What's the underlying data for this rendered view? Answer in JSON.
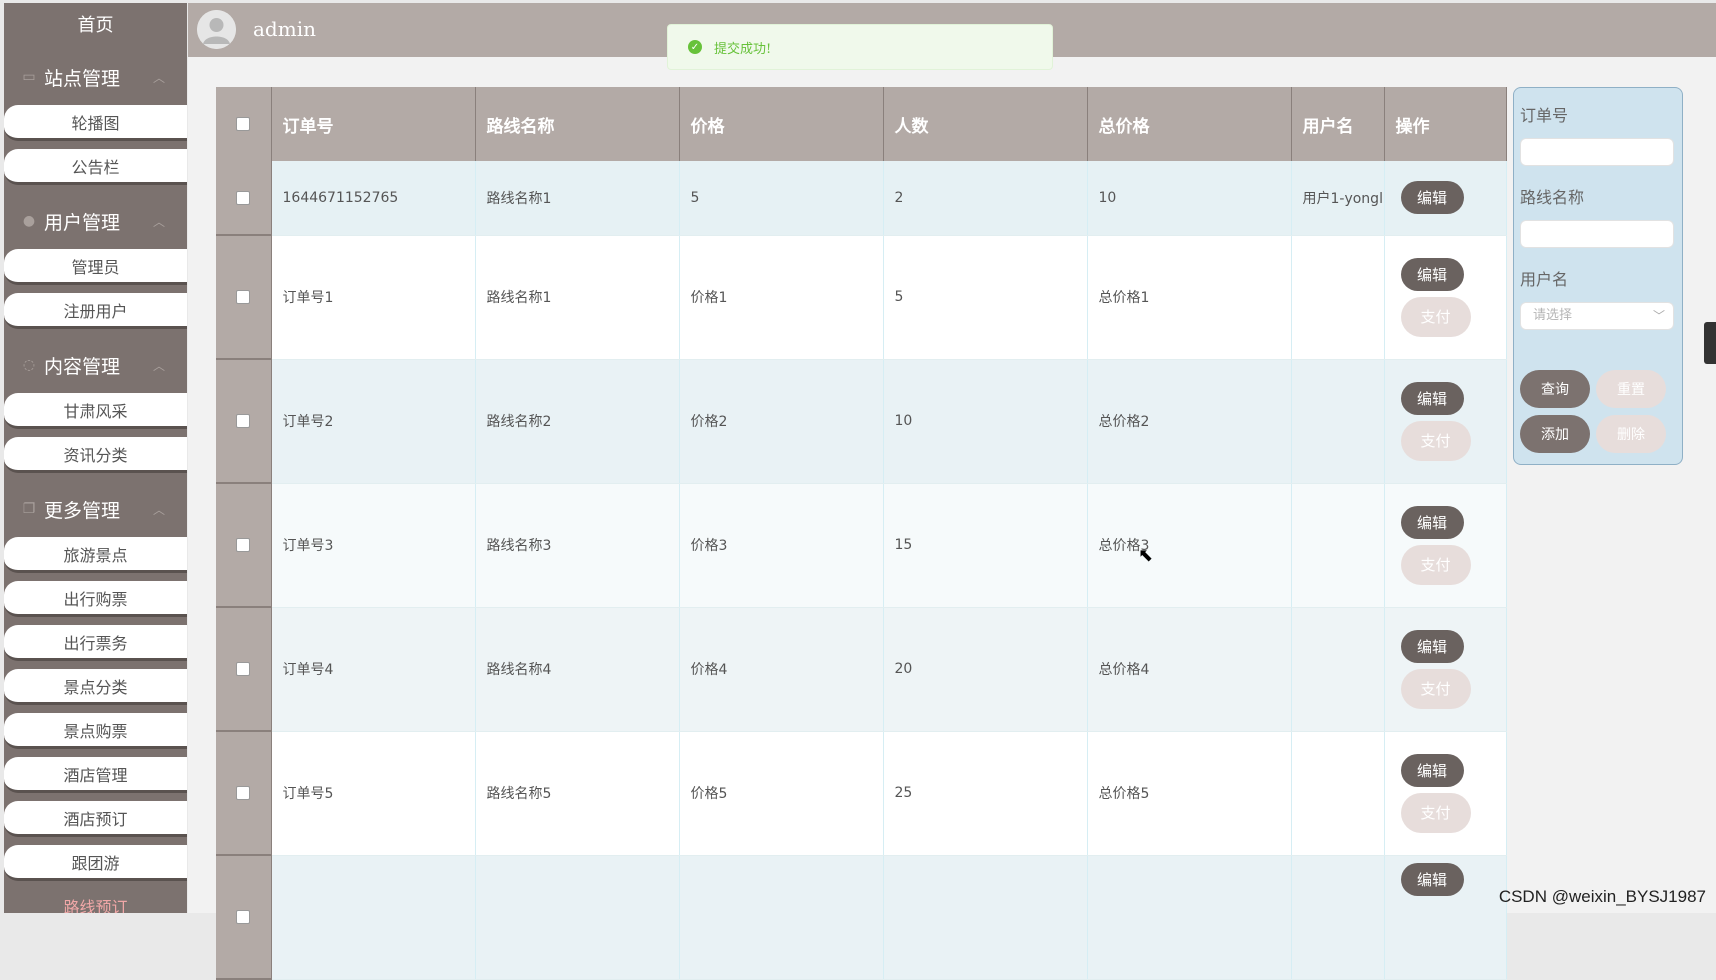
{
  "sidebar": {
    "home": "首页",
    "groups": [
      {
        "title": "站点管理",
        "items": [
          "轮播图",
          "公告栏"
        ]
      },
      {
        "title": "用户管理",
        "items": [
          "管理员",
          "注册用户"
        ]
      },
      {
        "title": "内容管理",
        "items": [
          "甘肃风采",
          "资讯分类"
        ]
      },
      {
        "title": "更多管理",
        "items": [
          "旅游景点",
          "出行购票",
          "出行票务",
          "景点分类",
          "景点购票",
          "酒店管理",
          "酒店预订",
          "跟团游",
          "路线预订"
        ]
      }
    ],
    "active_item": "路线预订"
  },
  "header": {
    "username": "admin"
  },
  "toast": {
    "message": "提交成功!",
    "type": "success"
  },
  "table": {
    "columns": [
      "订单号",
      "路线名称",
      "价格",
      "人数",
      "总价格",
      "用户名",
      "操作"
    ],
    "rows": [
      {
        "order_no": "1644671152765",
        "route": "路线名称1",
        "price": "5",
        "people": "2",
        "total": "10",
        "user": "用户1-yongl",
        "actions": [
          "编辑"
        ]
      },
      {
        "order_no": "订单号1",
        "route": "路线名称1",
        "price": "价格1",
        "people": "5",
        "total": "总价格1",
        "user": "",
        "actions": [
          "编辑",
          "支付"
        ]
      },
      {
        "order_no": "订单号2",
        "route": "路线名称2",
        "price": "价格2",
        "people": "10",
        "total": "总价格2",
        "user": "",
        "actions": [
          "编辑",
          "支付"
        ]
      },
      {
        "order_no": "订单号3",
        "route": "路线名称3",
        "price": "价格3",
        "people": "15",
        "total": "总价格3",
        "user": "",
        "actions": [
          "编辑",
          "支付"
        ]
      },
      {
        "order_no": "订单号4",
        "route": "路线名称4",
        "price": "价格4",
        "people": "20",
        "total": "总价格4",
        "user": "",
        "actions": [
          "编辑",
          "支付"
        ]
      },
      {
        "order_no": "订单号5",
        "route": "路线名称5",
        "price": "价格5",
        "people": "25",
        "total": "总价格5",
        "user": "",
        "actions": [
          "编辑",
          "支付"
        ]
      },
      {
        "order_no": "",
        "route": "",
        "price": "",
        "people": "",
        "total": "",
        "user": "",
        "actions": [
          "编辑"
        ]
      }
    ]
  },
  "search": {
    "order_label": "订单号",
    "route_label": "路线名称",
    "user_label": "用户名",
    "user_placeholder": "请选择",
    "query": "查询",
    "reset": "重置",
    "add": "添加",
    "delete": "删除"
  },
  "watermark": "CSDN @weixin_BYSJ1987",
  "colors": {
    "sidebar_bg": "#7c726f",
    "header_bg": "#b3aaa6",
    "button_dark": "#6a625f",
    "button_light": "#e7dddb",
    "active_text": "#f0a7a7",
    "toast_green": "#67c23a"
  }
}
